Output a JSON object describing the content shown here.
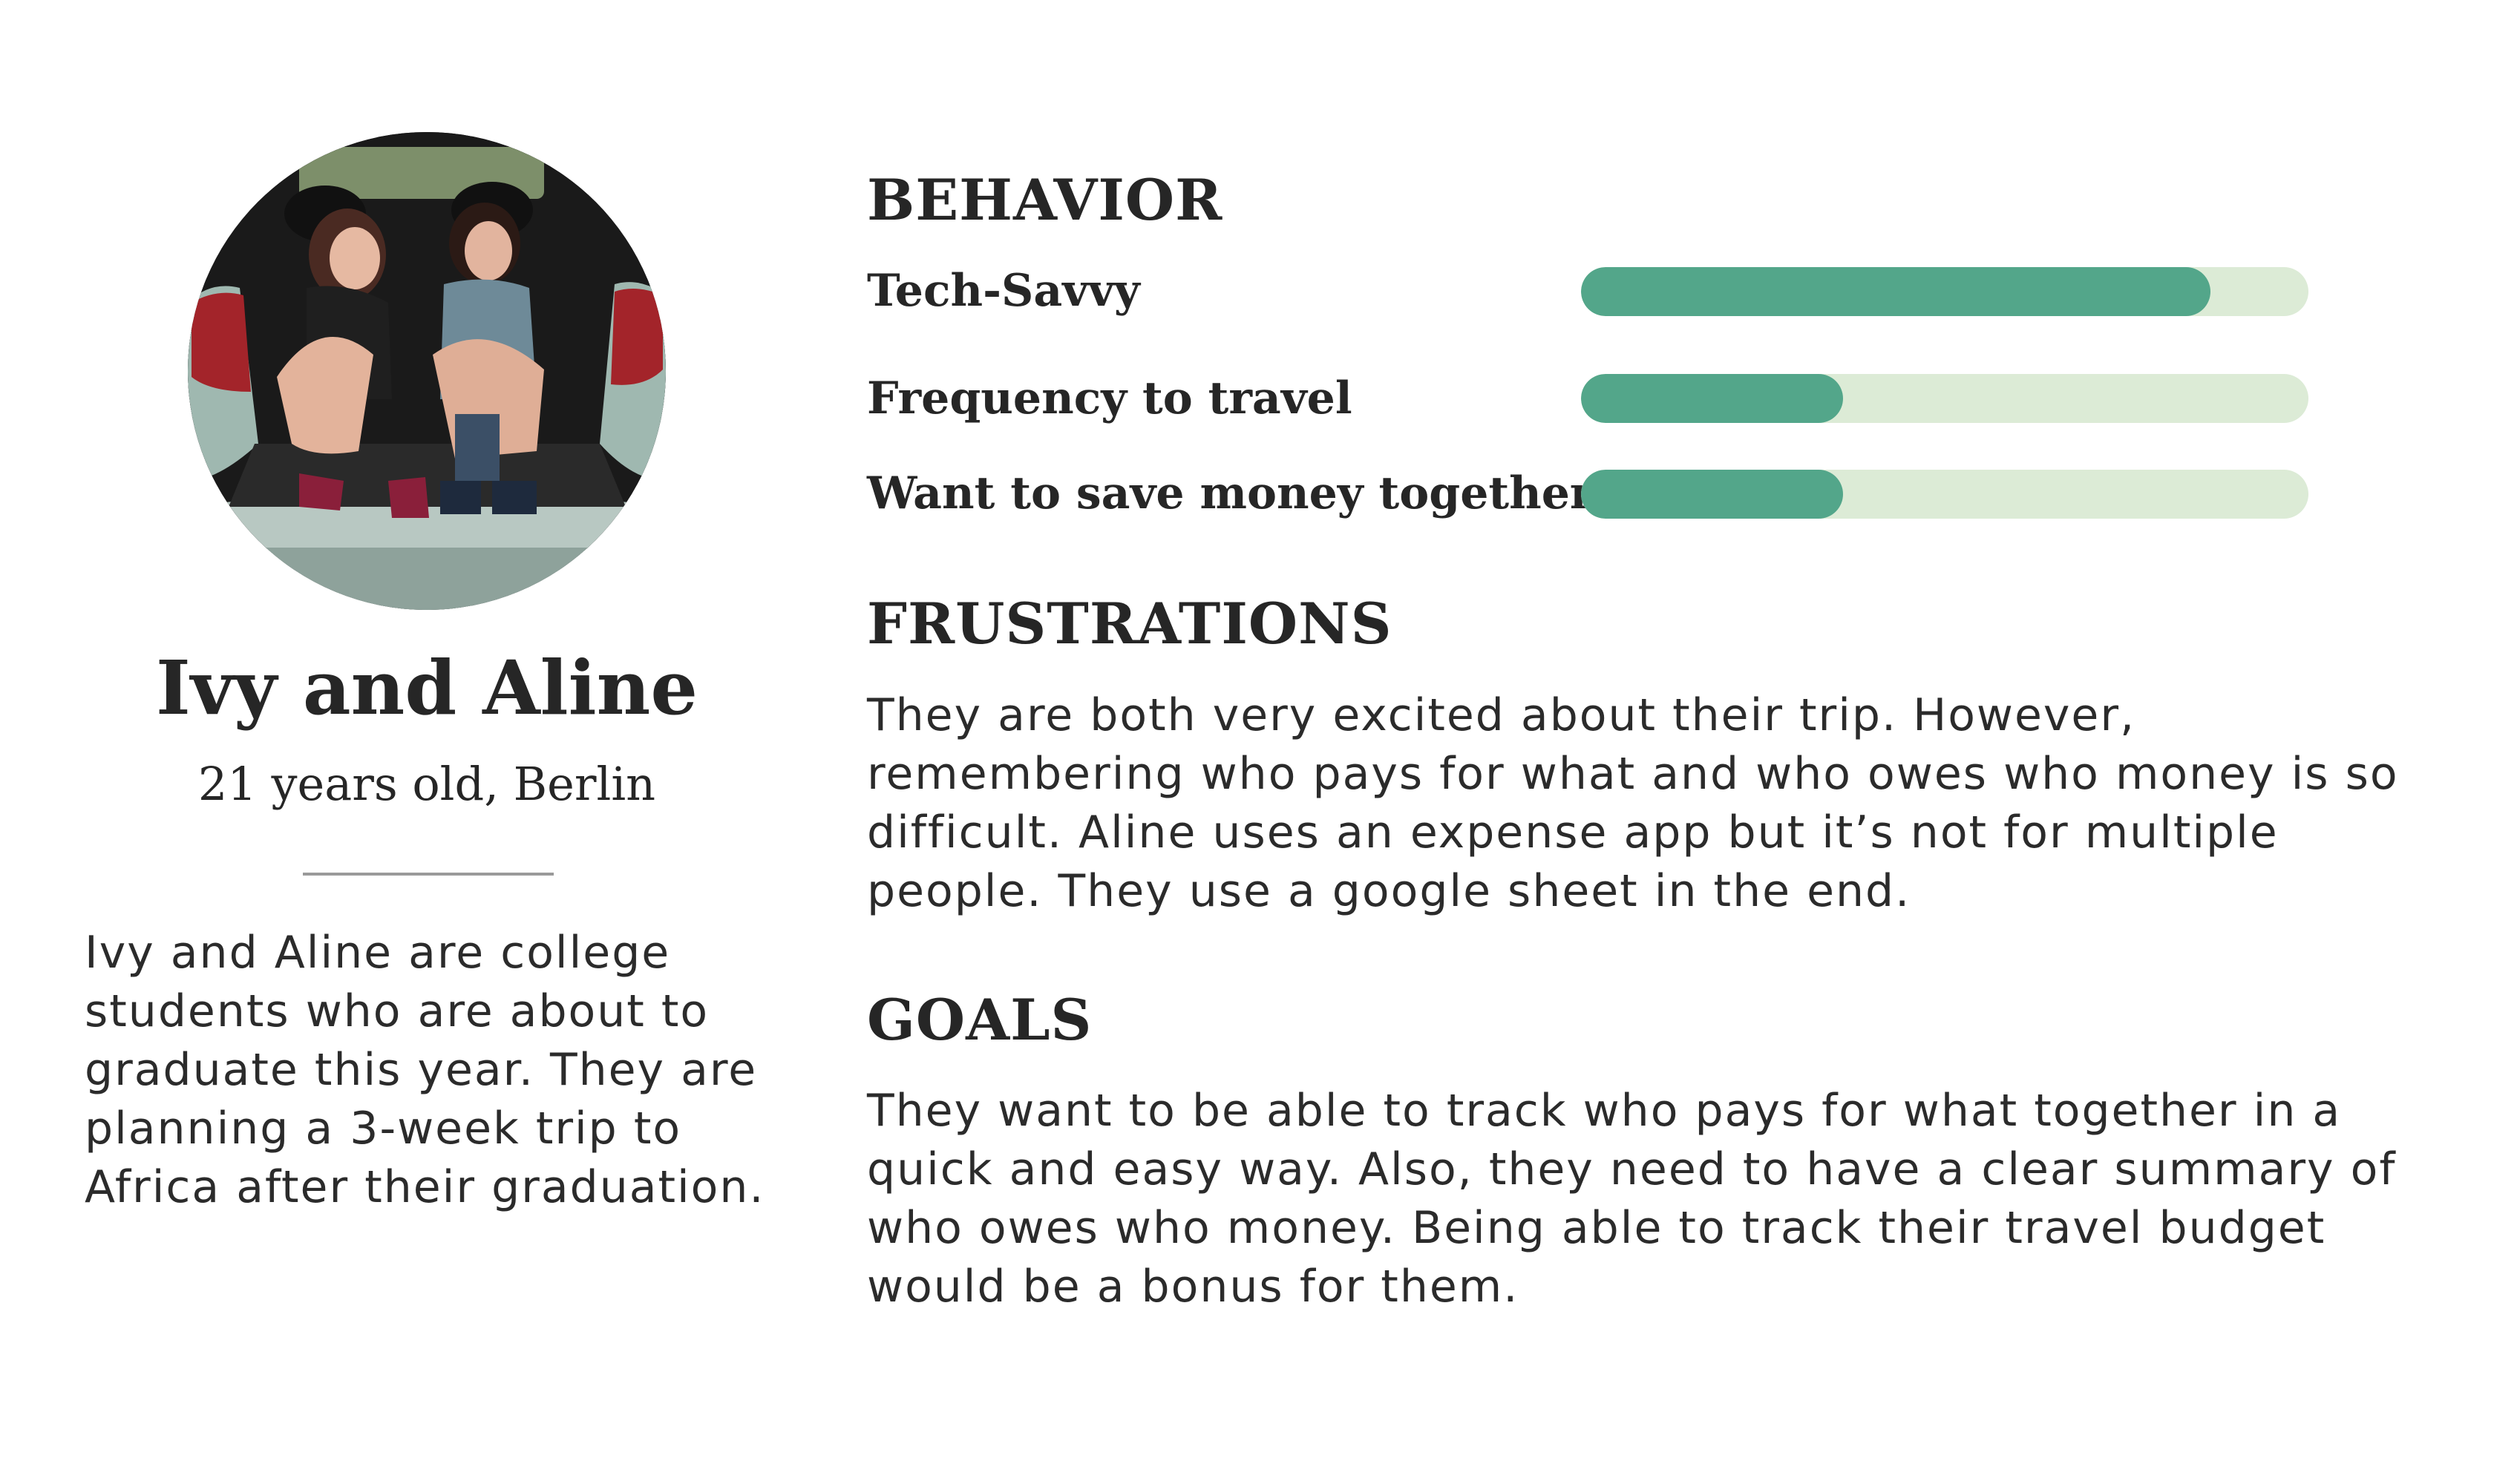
{
  "persona": {
    "photo_alt": "Two young women sitting in the open trunk of a car",
    "name": "Ivy and Aline",
    "subtitle": "21 years old, Berlin",
    "bio": "Ivy and Aline are college students who are about to graduate this year. They are planning a 3-week trip to Africa after their graduation."
  },
  "behavior": {
    "title": "BEHAVIOR",
    "metrics": [
      {
        "label": "Tech-Savvy",
        "value": 0.865
      },
      {
        "label": "Frequency to travel",
        "value": 0.36
      },
      {
        "label": "Want to save money together",
        "value": 0.36
      }
    ]
  },
  "frustrations": {
    "title": "FRUSTRATIONS",
    "text": "They are both very excited about their trip. However, remembering who pays for what and who owes who money is so difficult. Aline uses an expense app but it’s not for multiple people. They use a google sheet in the end."
  },
  "goals": {
    "title": "GOALS",
    "text": "They want to be able to track who pays for what together in a quick and easy way. Also, they need to have a clear summary of who owes who money. Being able to track their travel budget would be a bonus for them."
  },
  "colors": {
    "bar_fill": "#53a68a",
    "bar_track": "#dcebd6",
    "text": "#2b2b2b"
  }
}
